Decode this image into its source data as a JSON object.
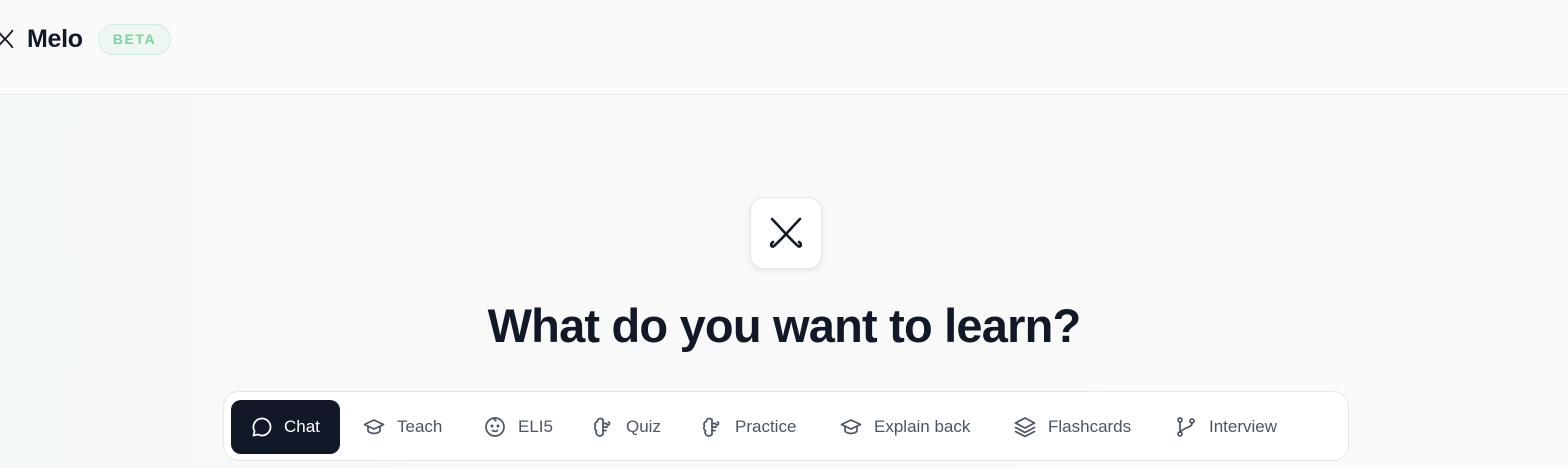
{
  "header": {
    "brand_name": "Melo",
    "badge": "BETA",
    "logo_icon": "melo-logo-icon"
  },
  "hero": {
    "logo_icon": "melo-logo-icon",
    "headline": "What do you want to learn?"
  },
  "modes": [
    {
      "label": "Chat",
      "icon": "chat-bubble-icon",
      "active": true
    },
    {
      "label": "Teach",
      "icon": "graduation-cap-icon",
      "active": false
    },
    {
      "label": "ELI5",
      "icon": "baby-face-icon",
      "active": false
    },
    {
      "label": "Quiz",
      "icon": "brain-icon",
      "active": false
    },
    {
      "label": "Practice",
      "icon": "brain-icon",
      "active": false
    },
    {
      "label": "Explain back",
      "icon": "graduation-cap-icon",
      "active": false
    },
    {
      "label": "Flashcards",
      "icon": "layers-icon",
      "active": false
    },
    {
      "label": "Interview",
      "icon": "git-branch-icon",
      "active": false
    }
  ],
  "colors": {
    "accent_dark": "#111827",
    "beta_green": "#7fd39e",
    "muted_text": "#4b5563"
  }
}
